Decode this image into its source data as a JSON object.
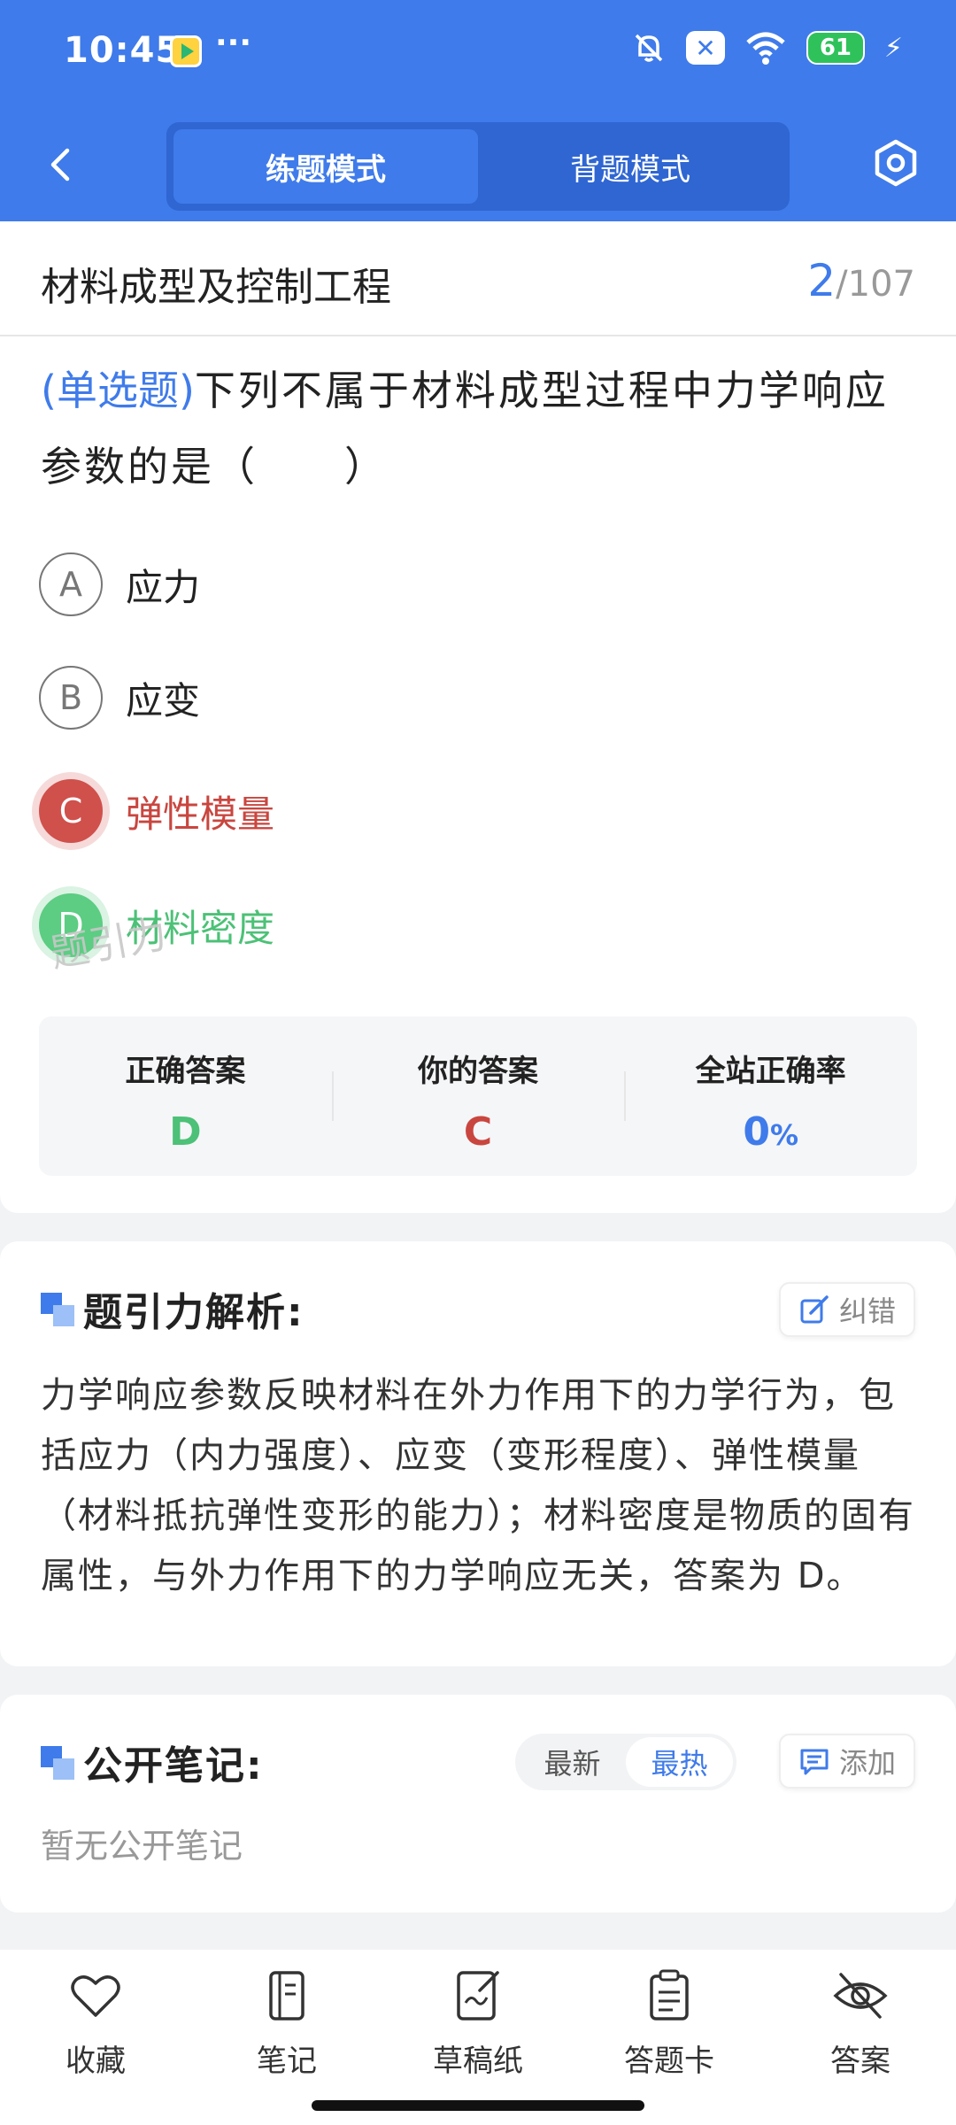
{
  "status_bar": {
    "time": "10:45",
    "dots": "···",
    "battery": "61",
    "x_label": "✕"
  },
  "colors": {
    "primary": "#3f7bea",
    "wrong": "#c9463f",
    "correct": "#4cc177"
  },
  "mode_tabs": [
    {
      "label": "练题模式",
      "active": true
    },
    {
      "label": "背题模式",
      "active": false
    }
  ],
  "course": {
    "title": "材料成型及控制工程",
    "current": "2",
    "total": "/107"
  },
  "question": {
    "type": "(单选题)",
    "text": "下列不属于材料成型过程中力学响应参数的是（　　）"
  },
  "options": [
    {
      "letter": "A",
      "text": "应力",
      "state": "normal"
    },
    {
      "letter": "B",
      "text": "应变",
      "state": "normal"
    },
    {
      "letter": "C",
      "text": "弹性模量",
      "state": "wrong"
    },
    {
      "letter": "D",
      "text": "材料密度",
      "state": "correct"
    }
  ],
  "answer_panel": {
    "correct_label": "正确答案",
    "correct_value": "D",
    "yours_label": "你的答案",
    "yours_value": "C",
    "rate_label": "全站正确率",
    "rate_value": "0",
    "rate_unit": "%",
    "watermark": "题引力"
  },
  "analysis": {
    "title": "题引力解析:",
    "report_label": "纠错",
    "text": "力学响应参数反映材料在外力作用下的力学行为，包括应力（内力强度）、应变（变形程度）、弹性模量（材料抵抗弹性变形的能力）；材料密度是物质的固有属性，与外力作用下的力学响应无关，答案为 D。"
  },
  "notes": {
    "title": "公开笔记:",
    "sort_latest": "最新",
    "sort_hot": "最热",
    "add_label": "添加",
    "empty_text": "暂无公开笔记"
  },
  "bottom_tabs": [
    {
      "label": "收藏",
      "icon": "heart-icon"
    },
    {
      "label": "笔记",
      "icon": "notebook-icon"
    },
    {
      "label": "草稿纸",
      "icon": "draft-paper-icon"
    },
    {
      "label": "答题卡",
      "icon": "answer-sheet-icon"
    },
    {
      "label": "答案",
      "icon": "eye-off-icon"
    }
  ]
}
